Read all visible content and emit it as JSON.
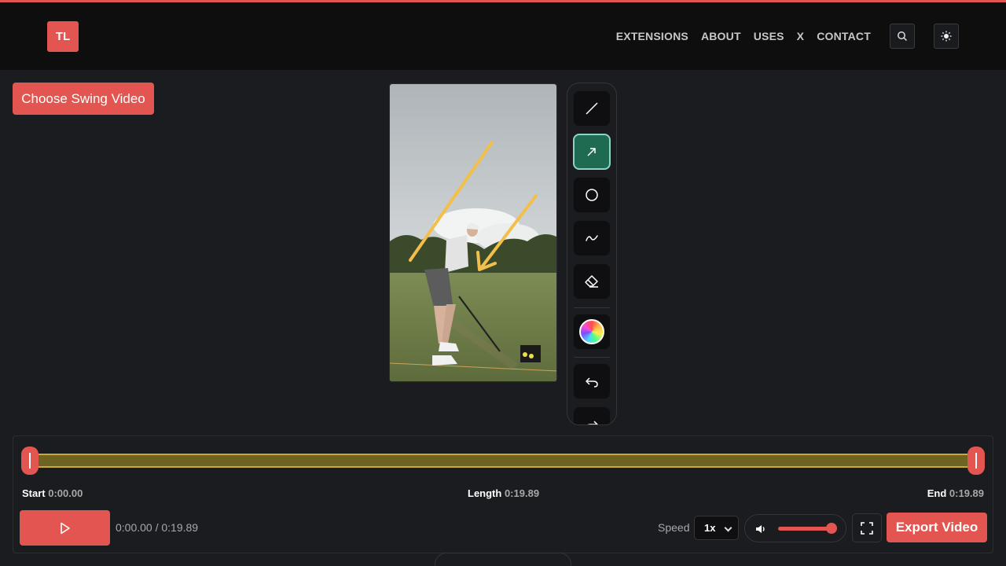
{
  "header": {
    "logo_text": "TL",
    "nav": [
      "EXTENSIONS",
      "ABOUT",
      "USES",
      "X",
      "CONTACT"
    ],
    "search_icon": "search-icon",
    "theme_icon": "sun-icon"
  },
  "choose_label": "Choose Swing Video",
  "toolbar": {
    "tools": [
      "line-icon",
      "arrow-icon",
      "circle-icon",
      "freehand-icon",
      "eraser-icon",
      "color-wheel-icon",
      "undo-icon",
      "redo-icon"
    ],
    "active_tool": "arrow-icon"
  },
  "timeline": {
    "start_label": "Start",
    "start_value": "0:00.00",
    "length_label": "Length",
    "length_value": "0:19.89",
    "end_label": "End",
    "end_value": "0:19.89",
    "time_display": "0:00.00 / 0:19.89",
    "speed_label": "Speed",
    "speed_value": "1x",
    "volume_level": 0.95,
    "export_label": "Export Video"
  },
  "colors": {
    "accent": "#e25550",
    "active_tool": "#1f6b52",
    "annotation": "#f2c04a"
  }
}
